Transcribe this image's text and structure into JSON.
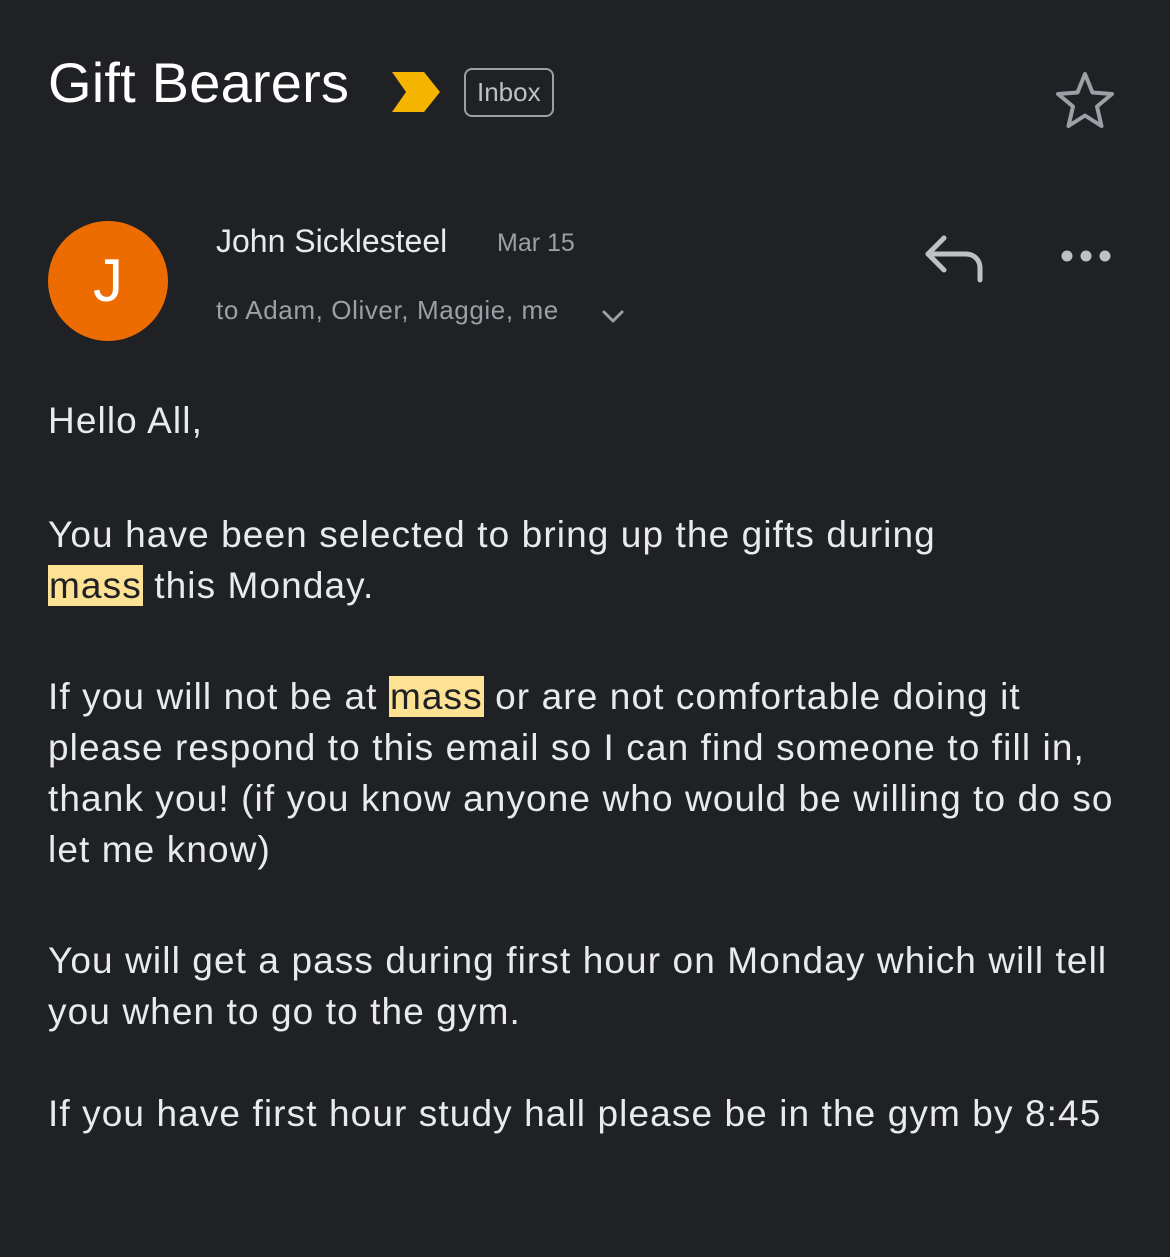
{
  "subject": "Gift Bearers",
  "label": "Inbox",
  "sender": {
    "initial": "J",
    "name": "John Sicklesteel",
    "date": "Mar 15",
    "recipients": "to Adam, Oliver, Maggie, me"
  },
  "colors": {
    "background": "#202124",
    "avatar": "#ed6c02",
    "importance_marker": "#f4b400",
    "highlight": "#fde293"
  },
  "icons": {
    "importance": "importance-marker-icon",
    "star": "star-icon",
    "reply": "reply-icon",
    "more": "more-horizontal-icon",
    "expand": "chevron-down-icon"
  },
  "body": {
    "greeting": "Hello All,",
    "p1": {
      "a": "You have been selected to bring up the gifts during",
      "hl": "mass",
      "b": " this Monday."
    },
    "p2": {
      "a": "If you will not be at ",
      "hl": "mass",
      "b": " or are not comfortable doing it please respond to this email so I can find someone to fill in, thank you! (if you know anyone who would be willing to do so let me know)"
    },
    "p3": "You will get a pass during first hour on Monday which will tell you when to go to the gym.",
    "p4": "If you have first hour study hall please be in the gym by 8:45"
  }
}
